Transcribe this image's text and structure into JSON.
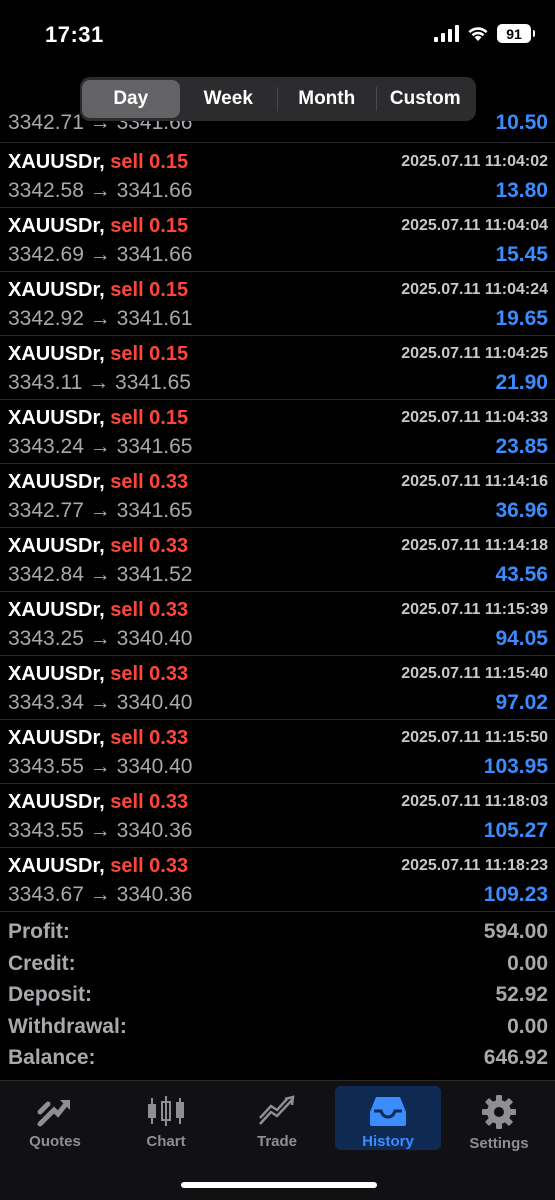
{
  "status_bar": {
    "time": "17:31",
    "battery": "91",
    "icons": [
      "signal-icon",
      "wifi-icon",
      "battery-icon"
    ]
  },
  "period_tabs": [
    {
      "label": "Day",
      "active": true
    },
    {
      "label": "Week",
      "active": false
    },
    {
      "label": "Month",
      "active": false
    },
    {
      "label": "Custom",
      "active": false
    }
  ],
  "partial_row": {
    "prices": "3342.71 → 3341.66",
    "profit": "10.50"
  },
  "deals": [
    {
      "symbol": "XAUUSDr,",
      "side": "sell 0.15",
      "prices": "3342.58 → 3341.66",
      "time": "2025.07.11 11:04:02",
      "profit": "13.80"
    },
    {
      "symbol": "XAUUSDr,",
      "side": "sell 0.15",
      "prices": "3342.69 → 3341.66",
      "time": "2025.07.11 11:04:04",
      "profit": "15.45"
    },
    {
      "symbol": "XAUUSDr,",
      "side": "sell 0.15",
      "prices": "3342.92 → 3341.61",
      "time": "2025.07.11 11:04:24",
      "profit": "19.65"
    },
    {
      "symbol": "XAUUSDr,",
      "side": "sell 0.15",
      "prices": "3343.11 → 3341.65",
      "time": "2025.07.11 11:04:25",
      "profit": "21.90"
    },
    {
      "symbol": "XAUUSDr,",
      "side": "sell 0.15",
      "prices": "3343.24 → 3341.65",
      "time": "2025.07.11 11:04:33",
      "profit": "23.85"
    },
    {
      "symbol": "XAUUSDr,",
      "side": "sell 0.33",
      "prices": "3342.77 → 3341.65",
      "time": "2025.07.11 11:14:16",
      "profit": "36.96"
    },
    {
      "symbol": "XAUUSDr,",
      "side": "sell 0.33",
      "prices": "3342.84 → 3341.52",
      "time": "2025.07.11 11:14:18",
      "profit": "43.56"
    },
    {
      "symbol": "XAUUSDr,",
      "side": "sell 0.33",
      "prices": "3343.25 → 3340.40",
      "time": "2025.07.11 11:15:39",
      "profit": "94.05"
    },
    {
      "symbol": "XAUUSDr,",
      "side": "sell 0.33",
      "prices": "3343.34 → 3340.40",
      "time": "2025.07.11 11:15:40",
      "profit": "97.02"
    },
    {
      "symbol": "XAUUSDr,",
      "side": "sell 0.33",
      "prices": "3343.55 → 3340.40",
      "time": "2025.07.11 11:15:50",
      "profit": "103.95"
    },
    {
      "symbol": "XAUUSDr,",
      "side": "sell 0.33",
      "prices": "3343.55 → 3340.36",
      "time": "2025.07.11 11:18:03",
      "profit": "105.27"
    },
    {
      "symbol": "XAUUSDr,",
      "side": "sell 0.33",
      "prices": "3343.67 → 3340.36",
      "time": "2025.07.11 11:18:23",
      "profit": "109.23"
    }
  ],
  "summary": [
    {
      "label": "Profit:",
      "value": "594.00"
    },
    {
      "label": "Credit:",
      "value": "0.00"
    },
    {
      "label": "Deposit:",
      "value": "52.92"
    },
    {
      "label": "Withdrawal:",
      "value": "0.00"
    },
    {
      "label": "Balance:",
      "value": "646.92"
    }
  ],
  "tabbar": [
    {
      "label": "Quotes",
      "icon": "quotes-icon",
      "active": false
    },
    {
      "label": "Chart",
      "icon": "candlestick-chart-icon",
      "active": false
    },
    {
      "label": "Trade",
      "icon": "trade-icon",
      "active": false
    },
    {
      "label": "History",
      "icon": "history-inbox-icon",
      "active": true
    },
    {
      "label": "Settings",
      "icon": "gear-icon",
      "active": false
    }
  ],
  "colors": {
    "sell": "#ff453a",
    "profit": "#3b8cff",
    "active_tab": "#3b8cff",
    "background": "#000000"
  }
}
